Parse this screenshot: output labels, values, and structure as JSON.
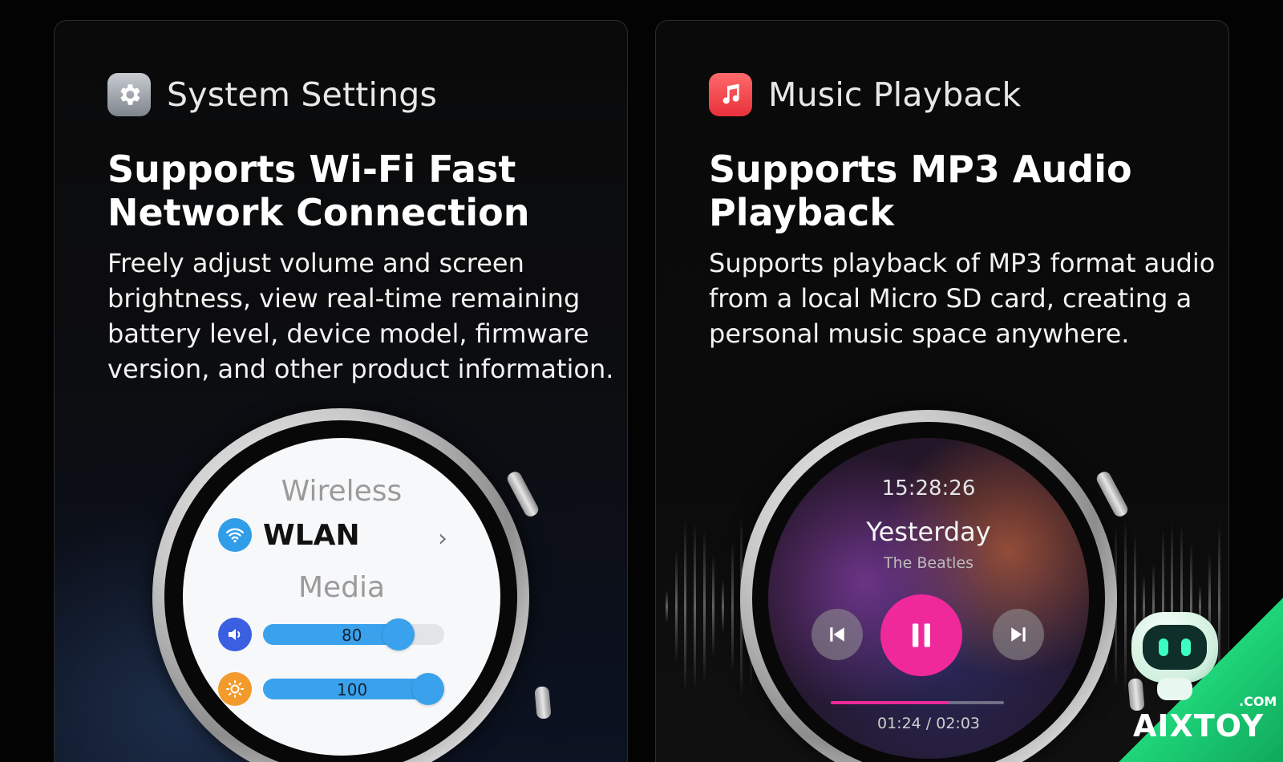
{
  "left_card": {
    "icon": "gear-icon",
    "feature_title": "System Settings",
    "headline_line1": "Supports Wi-Fi Fast",
    "headline_line2": "Network Connection",
    "description": "Freely adjust volume and screen brightness, view real-time remaining battery level, device model, firmware version, and other product information.",
    "watch": {
      "section_wireless": "Wireless",
      "wlan_label": "WLAN",
      "wlan_icon": "wifi-icon",
      "chevron": "›",
      "section_media": "Media",
      "volume_icon": "speaker-icon",
      "volume_value": "80",
      "volume_level": 0.8,
      "brightness_icon": "brightness-icon",
      "brightness_value": "100",
      "brightness_level": 1.0,
      "accent_color": "#3aa2ec"
    }
  },
  "right_card": {
    "icon": "music-note-icon",
    "feature_title": "Music Playback",
    "headline_line1": "Supports MP3 Audio",
    "headline_line2": "Playback",
    "description": "Supports playback of MP3 format audio from a local Micro SD card, creating a personal music space anywhere.",
    "watch": {
      "clock": "15:28:26",
      "song_title": "Yesterday",
      "artist": "The Beatles",
      "elapsed_time": "01:24",
      "total_time": "02:03",
      "time_separator": " / ",
      "progress": 0.68,
      "play_color": "#f0299a"
    }
  },
  "logo": {
    "suffix": ".COM",
    "brand": "AIXTOY",
    "brand_color": "#1fd67a"
  }
}
